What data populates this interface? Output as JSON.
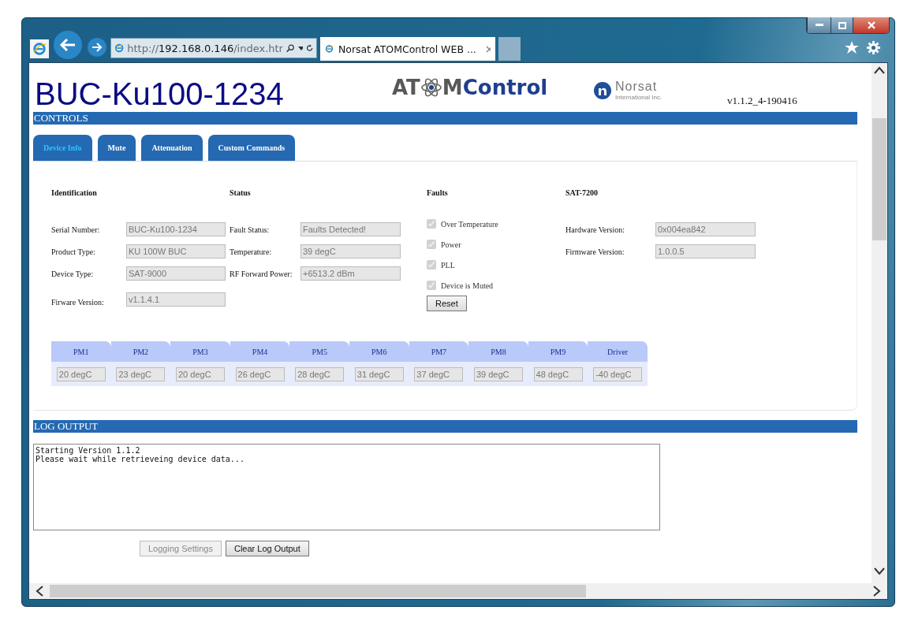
{
  "browser": {
    "address": {
      "scheme": "http://",
      "host": "192.168.0.146",
      "path": "/index.htr"
    },
    "tabs": [
      {
        "title": "Norsat ATOMControl WEB ...",
        "selected": true
      }
    ]
  },
  "header": {
    "device_title": "BUC-Ku100-1234",
    "atom_logo": {
      "left": "AT",
      "middle": "M",
      "right": "Control"
    },
    "norsat_logo": {
      "name": "Norsat",
      "subtitle": "International Inc."
    },
    "version": "v1.1.2_4-190416"
  },
  "controls": {
    "title": "CONTROLS",
    "tabs": [
      {
        "label": "Device Info",
        "selected": true
      },
      {
        "label": "Mute",
        "selected": false
      },
      {
        "label": "Attenuation",
        "selected": false
      },
      {
        "label": "Custom Commands",
        "selected": false
      }
    ]
  },
  "identification": {
    "title": "Identification",
    "fields": [
      {
        "label": "Serial Number:",
        "value": "BUC-Ku100-1234"
      },
      {
        "label": "Product Type:",
        "value": "KU 100W BUC"
      },
      {
        "label": "Device Type:",
        "value": "SAT-9000"
      },
      {
        "label": "Firware Version:",
        "value": "v1.1.4.1"
      }
    ]
  },
  "status": {
    "title": "Status",
    "fields": [
      {
        "label": "Fault Status:",
        "value": "Faults Detected!"
      },
      {
        "label": "Temperature:",
        "value": "39 degC"
      },
      {
        "label": "RF Forward Power:",
        "value": "+6513.2 dBm"
      }
    ]
  },
  "faults": {
    "title": "Faults",
    "items": [
      {
        "label": "Over Temperature",
        "checked": true,
        "disabled": true
      },
      {
        "label": "Power",
        "checked": true,
        "disabled": true
      },
      {
        "label": "PLL",
        "checked": true,
        "disabled": true
      },
      {
        "label": "Device is Muted",
        "checked": true,
        "disabled": true
      }
    ],
    "reset_button": "Reset"
  },
  "sat_7200": {
    "title": "SAT-7200",
    "fields": [
      {
        "label": "Hardware Version:",
        "value": "0x004ea842"
      },
      {
        "label": "Firmware Version:",
        "value": "1.0.0.5"
      }
    ]
  },
  "temperatures": [
    {
      "name": "PM1",
      "value": "20 degC"
    },
    {
      "name": "PM2",
      "value": "23 degC"
    },
    {
      "name": "PM3",
      "value": "20 degC"
    },
    {
      "name": "PM4",
      "value": "26 degC"
    },
    {
      "name": "PM5",
      "value": "28 degC"
    },
    {
      "name": "PM6",
      "value": "31 degC"
    },
    {
      "name": "PM7",
      "value": "37 degC"
    },
    {
      "name": "PM8",
      "value": "39 degC"
    },
    {
      "name": "PM9",
      "value": "48 degC"
    },
    {
      "name": "Driver",
      "value": "-40 degC"
    }
  ],
  "log_output": {
    "title": "LOG OUTPUT",
    "lines": [
      "Starting Version 1.1.2",
      "Please wait while retrieveing device data..."
    ],
    "buttons": [
      {
        "label": "Logging Settings",
        "disabled": true
      },
      {
        "label": "Clear Log Output",
        "disabled": false
      }
    ]
  }
}
